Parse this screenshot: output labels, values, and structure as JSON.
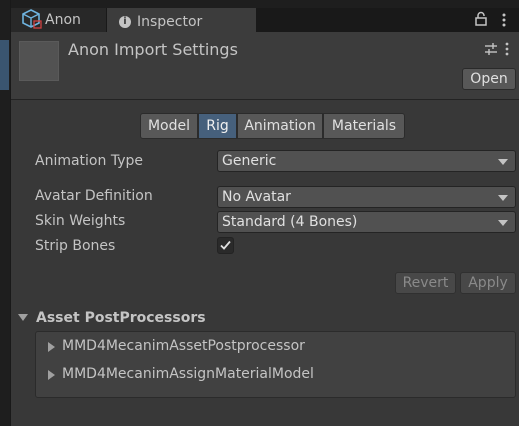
{
  "tabs": {
    "anon_label": "Anon",
    "inspector_label": "Inspector"
  },
  "header": {
    "title": "Anon Import Settings",
    "open_label": "Open"
  },
  "segments": {
    "model": "Model",
    "rig": "Rig",
    "animation": "Animation",
    "materials": "Materials",
    "active": "Rig"
  },
  "fields": {
    "animation_type": {
      "label": "Animation Type",
      "value": "Generic"
    },
    "avatar_definition": {
      "label": "Avatar Definition",
      "value": "No Avatar"
    },
    "skin_weights": {
      "label": "Skin Weights",
      "value": "Standard (4 Bones)"
    },
    "strip_bones": {
      "label": "Strip Bones",
      "checked": true
    }
  },
  "actions": {
    "revert_label": "Revert",
    "apply_label": "Apply"
  },
  "postprocessors": {
    "header": "Asset PostProcessors",
    "items": [
      "MMD4MecanimAssetPostprocessor",
      "MMD4MecanimAssignMaterialModel"
    ]
  },
  "colors": {
    "accent": "#46607c",
    "background": "#383838"
  },
  "icons": {
    "prefab": "prefab-cube-icon",
    "info": "info-icon",
    "lock": "lock-icon",
    "more": "kebab-menu-icon",
    "settings": "preset-sliders-icon"
  }
}
